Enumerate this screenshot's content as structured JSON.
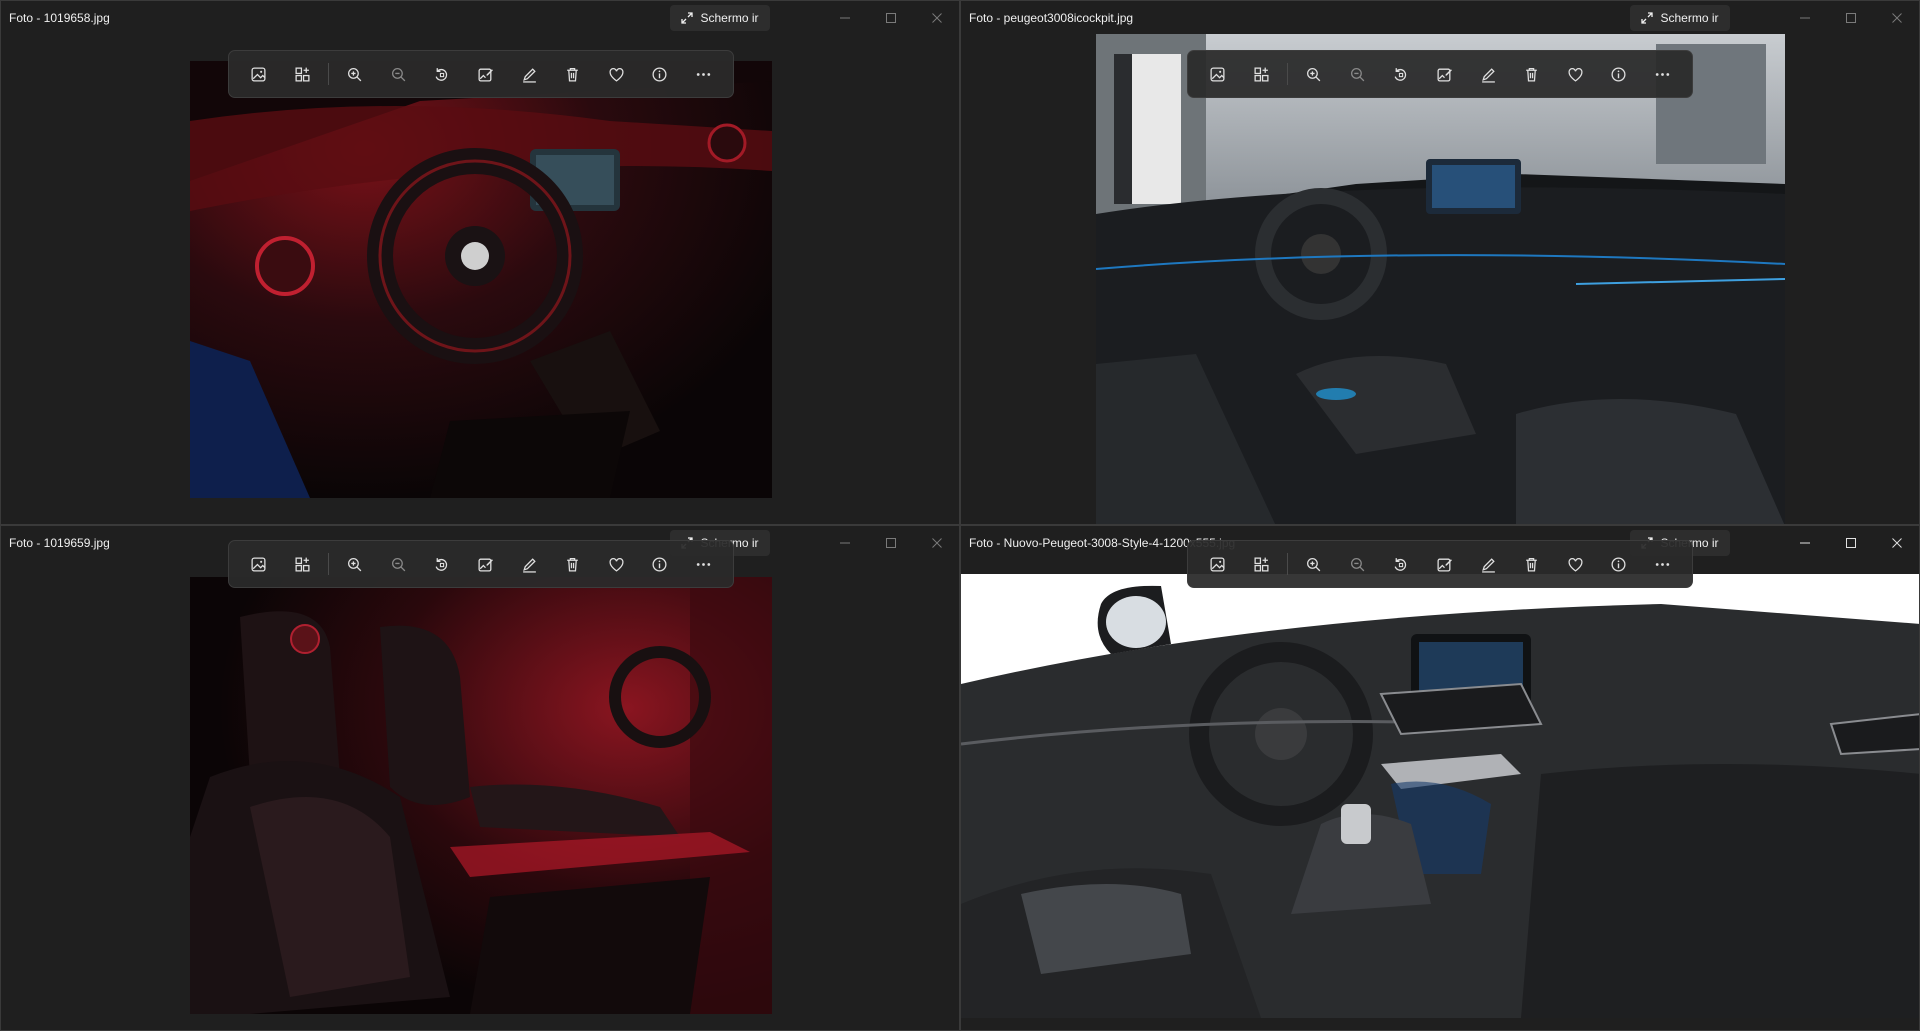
{
  "colors": {
    "window_bg": "#1f1f1f",
    "toolbar_bg": "#2b2b2b",
    "text": "#f0f0f0",
    "icon": "#e0e0e0",
    "disabled_icon": "#8a8a8a"
  },
  "windows": [
    {
      "title": "Foto - 1019658.jpg",
      "fullscreen_label": "Schermo ir",
      "image_subject": "dark red car cockpit with steering wheel"
    },
    {
      "title": "Foto - peugeot3008icockpit.jpg",
      "fullscreen_label": "Schermo ir",
      "image_subject": "peugeot cockpit with blue ambient lighting"
    },
    {
      "title": "Foto - 1019659.jpg",
      "fullscreen_label": "Schermo ir",
      "image_subject": "dark red car front seats"
    },
    {
      "title": "Foto - Nuovo-Peugeot-3008-Style-4-1200x555.jpg",
      "fullscreen_label": "Schermo ir",
      "image_subject": "peugeot interior dashboard on white background"
    }
  ],
  "toolbar_icons": [
    "image-icon",
    "gallery-icon",
    "zoom-in-icon",
    "zoom-out-icon",
    "rotate-icon",
    "edit-image-icon",
    "draw-icon",
    "delete-icon",
    "favorite-icon",
    "info-icon",
    "more-icon"
  ],
  "window_controls": [
    "minimize-icon",
    "maximize-icon",
    "close-icon"
  ]
}
